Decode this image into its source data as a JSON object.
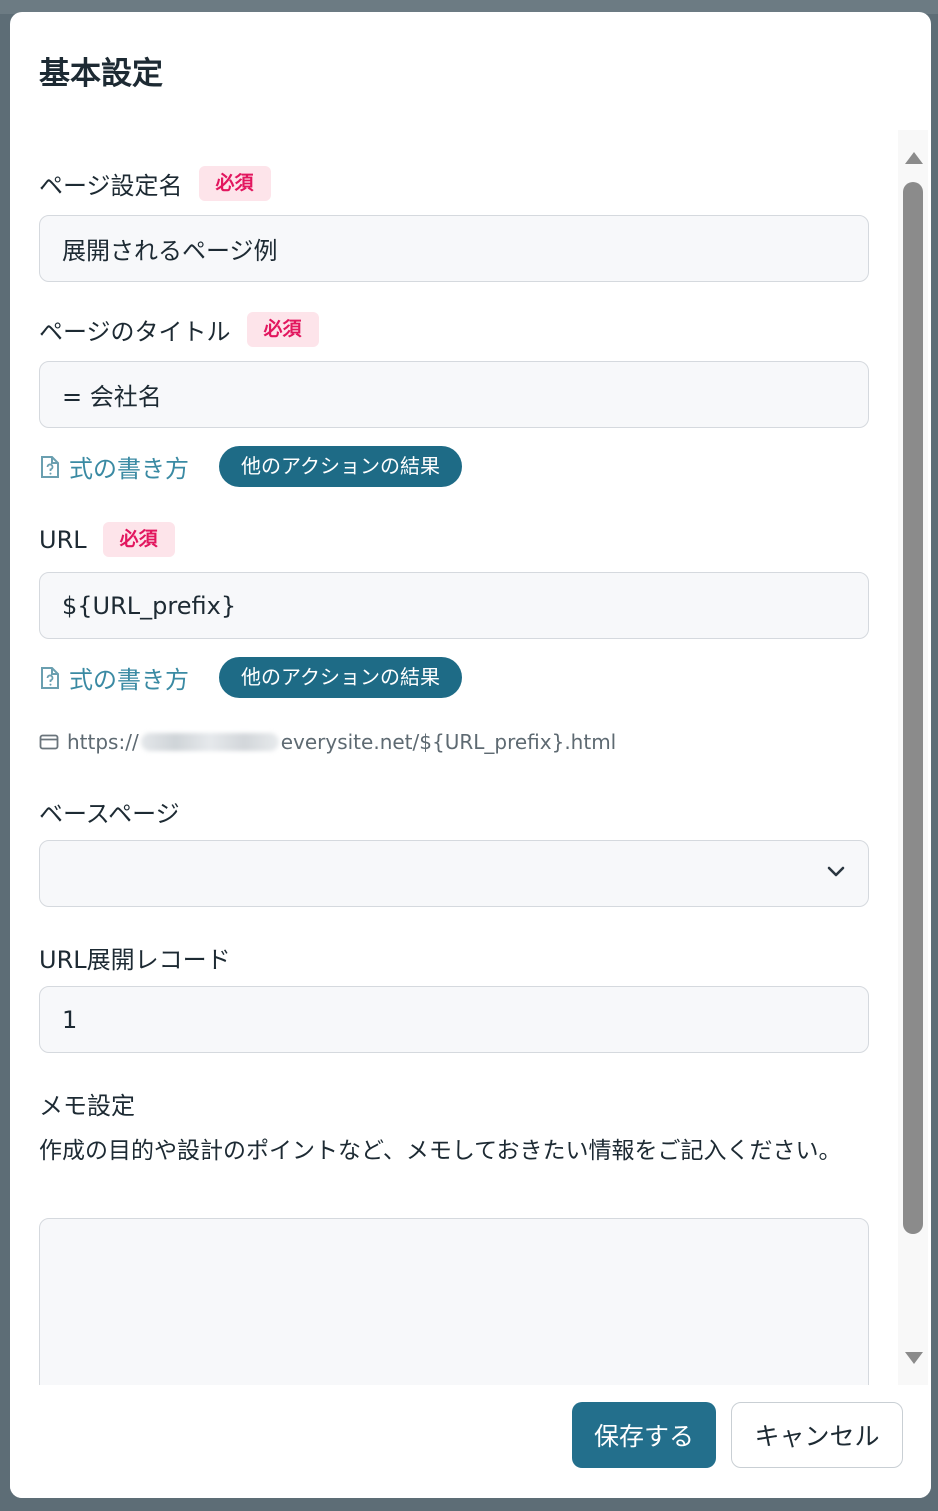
{
  "modal": {
    "title": "基本設定"
  },
  "fields": {
    "page_setting_name": {
      "label": "ページ設定名",
      "badge": "必須",
      "value": "展開されるページ例"
    },
    "page_title": {
      "label": "ページのタイトル",
      "badge": "必須",
      "value": "= 会社名",
      "formula_link": "式の書き方",
      "action_pill": "他のアクションの結果"
    },
    "url": {
      "label": "URL",
      "badge": "必須",
      "value": "${URL_prefix}",
      "formula_link": "式の書き方",
      "action_pill": "他のアクションの結果",
      "preview_prefix": "https://",
      "preview_suffix": "everysite.net/${URL_prefix}.html"
    },
    "base_page": {
      "label": "ベースページ",
      "value": ""
    },
    "url_record": {
      "label": "URL展開レコード",
      "value": "1"
    },
    "memo": {
      "label": "メモ設定",
      "help": "作成の目的や設計のポイントなど、メモしておきたい情報をご記入ください。",
      "value": ""
    }
  },
  "footer": {
    "save_label": "保存する",
    "cancel_label": "キャンセル"
  },
  "colors": {
    "primary": "#236f8c",
    "pill": "#1e6b86",
    "required_badge_bg": "#fde4ea",
    "required_badge_text": "#e2175f",
    "link": "#3a8aa3"
  },
  "icons": [
    "document-question-icon",
    "browser-window-icon",
    "chevron-down-icon",
    "scroll-up-arrow-icon",
    "scroll-down-arrow-icon"
  ]
}
